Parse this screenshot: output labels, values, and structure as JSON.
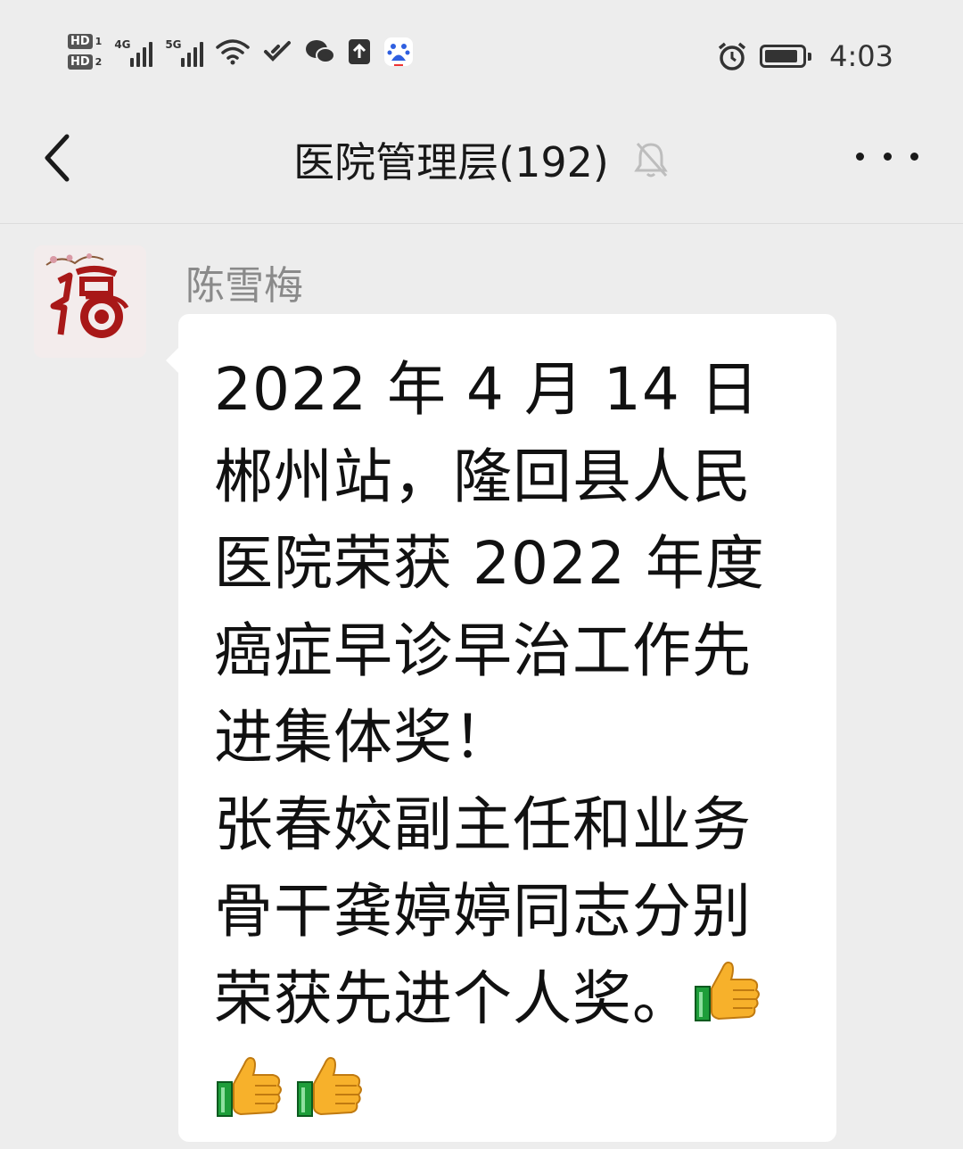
{
  "status_bar": {
    "sim1": "HD",
    "sim1_slot": "1",
    "sim2": "HD",
    "sim2_slot": "2",
    "net1": "4G",
    "net2": "5G",
    "time": "4:03",
    "battery_level": 0.9,
    "icons": [
      "wifi-icon",
      "link-icon",
      "wechat-icon",
      "upload-icon",
      "baidu-icon",
      "alarm-icon",
      "battery-icon"
    ]
  },
  "header": {
    "back_icon": "chevron-left-icon",
    "title": "医院管理层(192)",
    "mute_icon": "bell-off-icon",
    "more_icon": "more-icon"
  },
  "message": {
    "sender": "陈雪梅",
    "avatar_icon": "fu-papercut-avatar",
    "lines": [
      "2022 年 4 月 14 日",
      "郴州站，隆回县人民",
      "医院荣获 2022 年度",
      "癌症早诊早治工作先",
      "进集体奖！",
      "张春姣副主任和业务",
      "骨干龚婷婷同志分别",
      "荣获先进个人奖。"
    ],
    "emoji": [
      "thumbs-up-icon",
      "thumbs-up-icon",
      "thumbs-up-icon"
    ]
  },
  "colors": {
    "background": "#ededed",
    "bubble": "#ffffff",
    "sender_name": "#8a8a8a",
    "avatar_red": "#b01b1b"
  }
}
